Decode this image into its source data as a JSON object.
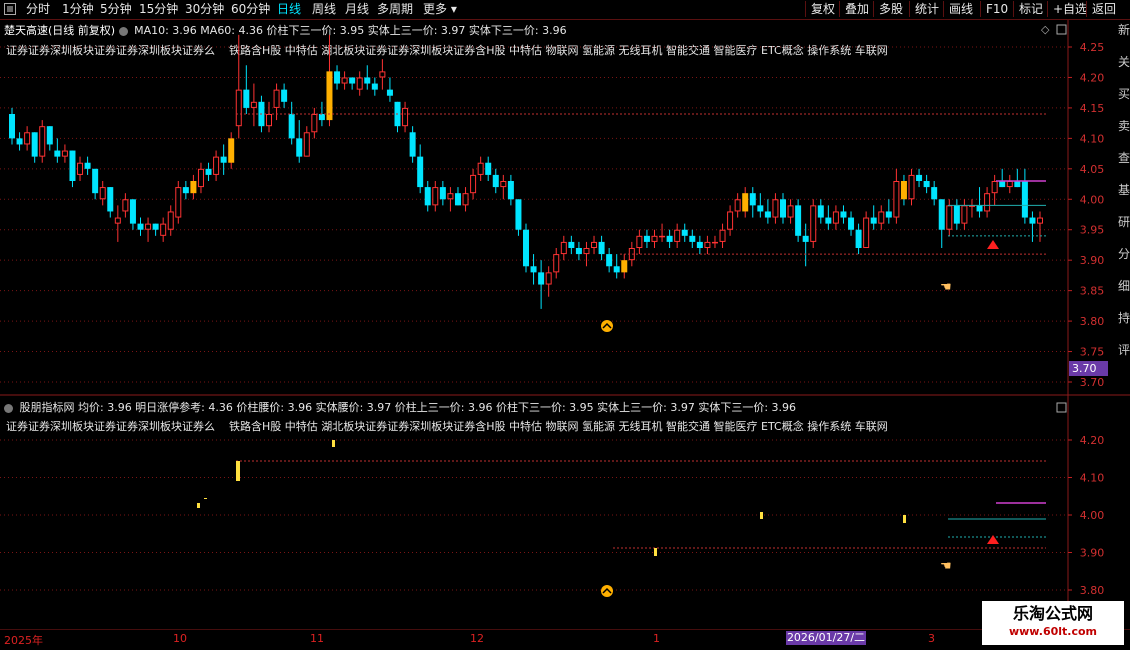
{
  "toolbar": {
    "items": [
      "分时",
      "1分钟",
      "5分钟",
      "15分钟",
      "30分钟",
      "60分钟",
      "日线",
      "周线",
      "月线",
      "多周期",
      "更多"
    ],
    "active": "日线",
    "right_items": [
      "复权",
      "叠加",
      "多股",
      "统计",
      "画线",
      "F10",
      "标记",
      "+自选",
      "返回"
    ]
  },
  "main_panel": {
    "stock_name": "楚天高速(日线 前复权)",
    "ma_text": "MA10: 3.96  MA60: 4.36  价柱下三一价: 3.95  实体上三一价: 3.97  实体下三一价: 3.96",
    "concepts": "证券证券深圳板块证券证券深圳板块证券么",
    "concepts2": "铁路含H股 中特估 湖北板块证券证券深圳板块证券含H股 中特估 物联网 氢能源 无线耳机 智能交通 智能医疗 ETC概念 操作系统 车联网",
    "y_ticks": [
      "4.25",
      "4.20",
      "4.15",
      "4.10",
      "4.05",
      "4.00",
      "3.95",
      "3.90",
      "3.85",
      "3.80",
      "3.75",
      "3.70"
    ],
    "price_tag": "3.70"
  },
  "sub_panel": {
    "indicator_text": "股朋指标网  均价: 3.96  明日涨停参考: 4.36  价柱腰价: 3.96  实体腰价: 3.97  价柱上三一价: 3.96  价柱下三一价: 3.95  实体上三一价: 3.97  实体下三一价: 3.96",
    "concepts": "证券证券深圳板块证券证券深圳板块证券么",
    "concepts2": "铁路含H股 中特估 湖北板块证券证券深圳板块证券含H股 中特估 物联网 氢能源 无线耳机 智能交通 智能医疗 ETC概念 操作系统 车联网",
    "y_ticks": [
      "4.20",
      "4.10",
      "4.00",
      "3.90",
      "3.80"
    ]
  },
  "time_axis": {
    "labels": [
      "2025年",
      "10",
      "11",
      "12",
      "1",
      "3"
    ],
    "date_tag": "2026/01/27/二"
  },
  "side_chars": [
    "新",
    "关",
    "买",
    "卖",
    "查",
    "基",
    "研",
    "分",
    "细",
    "持",
    "评"
  ],
  "watermark": {
    "title": "乐淘公式网",
    "url": "www.60lt.com"
  },
  "colors": {
    "up": "#ff3333",
    "down": "#00e5ff",
    "highlight": "#ffb000",
    "grid": "#7a1515",
    "axis_text": "#d23030",
    "marker": "#ff2020"
  },
  "chart_data": {
    "type": "candlestick",
    "ylim": [
      3.7,
      4.27
    ],
    "note_lines": {
      "upper_level": 4.14,
      "lower_level": 3.91
    },
    "candles": [
      {
        "o": 4.14,
        "h": 4.15,
        "l": 4.09,
        "c": 4.1
      },
      {
        "o": 4.1,
        "h": 4.11,
        "l": 4.08,
        "c": 4.09
      },
      {
        "o": 4.09,
        "h": 4.12,
        "l": 4.08,
        "c": 4.11
      },
      {
        "o": 4.11,
        "h": 4.11,
        "l": 4.06,
        "c": 4.07
      },
      {
        "o": 4.07,
        "h": 4.13,
        "l": 4.06,
        "c": 4.12
      },
      {
        "o": 4.12,
        "h": 4.12,
        "l": 4.08,
        "c": 4.09
      },
      {
        "o": 4.08,
        "h": 4.1,
        "l": 4.06,
        "c": 4.07
      },
      {
        "o": 4.07,
        "h": 4.09,
        "l": 4.06,
        "c": 4.08
      },
      {
        "o": 4.08,
        "h": 4.08,
        "l": 4.02,
        "c": 4.03
      },
      {
        "o": 4.04,
        "h": 4.07,
        "l": 4.03,
        "c": 4.06
      },
      {
        "o": 4.06,
        "h": 4.07,
        "l": 4.04,
        "c": 4.05
      },
      {
        "o": 4.05,
        "h": 4.05,
        "l": 4.0,
        "c": 4.01
      },
      {
        "o": 4.0,
        "h": 4.03,
        "l": 3.99,
        "c": 4.02
      },
      {
        "o": 4.02,
        "h": 4.02,
        "l": 3.97,
        "c": 3.98
      },
      {
        "o": 3.96,
        "h": 3.99,
        "l": 3.93,
        "c": 3.97
      },
      {
        "o": 3.98,
        "h": 4.01,
        "l": 3.97,
        "c": 4.0
      },
      {
        "o": 4.0,
        "h": 4.0,
        "l": 3.95,
        "c": 3.96
      },
      {
        "o": 3.96,
        "h": 3.97,
        "l": 3.94,
        "c": 3.95
      },
      {
        "o": 3.95,
        "h": 3.97,
        "l": 3.93,
        "c": 3.96
      },
      {
        "o": 3.96,
        "h": 3.96,
        "l": 3.94,
        "c": 3.95
      },
      {
        "o": 3.94,
        "h": 3.97,
        "l": 3.93,
        "c": 3.96
      },
      {
        "o": 3.95,
        "h": 3.99,
        "l": 3.94,
        "c": 3.98
      },
      {
        "o": 3.97,
        "h": 4.03,
        "l": 3.96,
        "c": 4.02
      },
      {
        "o": 4.02,
        "h": 4.03,
        "l": 4.0,
        "c": 4.01
      },
      {
        "o": 4.01,
        "h": 4.04,
        "l": 4.0,
        "c": 4.03,
        "hl": true
      },
      {
        "o": 4.02,
        "h": 4.06,
        "l": 4.01,
        "c": 4.05
      },
      {
        "o": 4.05,
        "h": 4.06,
        "l": 4.03,
        "c": 4.04
      },
      {
        "o": 4.04,
        "h": 4.08,
        "l": 4.03,
        "c": 4.07
      },
      {
        "o": 4.07,
        "h": 4.09,
        "l": 4.04,
        "c": 4.06
      },
      {
        "o": 4.06,
        "h": 4.11,
        "l": 4.05,
        "c": 4.1,
        "hl": true
      },
      {
        "o": 4.12,
        "h": 4.27,
        "l": 4.1,
        "c": 4.18
      },
      {
        "o": 4.18,
        "h": 4.22,
        "l": 4.14,
        "c": 4.15
      },
      {
        "o": 4.15,
        "h": 4.19,
        "l": 4.12,
        "c": 4.16
      },
      {
        "o": 4.16,
        "h": 4.17,
        "l": 4.11,
        "c": 4.12
      },
      {
        "o": 4.12,
        "h": 4.16,
        "l": 4.11,
        "c": 4.14
      },
      {
        "o": 4.15,
        "h": 4.19,
        "l": 4.13,
        "c": 4.18
      },
      {
        "o": 4.18,
        "h": 4.19,
        "l": 4.15,
        "c": 4.16
      },
      {
        "o": 4.14,
        "h": 4.16,
        "l": 4.09,
        "c": 4.1
      },
      {
        "o": 4.1,
        "h": 4.13,
        "l": 4.06,
        "c": 4.07
      },
      {
        "o": 4.07,
        "h": 4.12,
        "l": 4.07,
        "c": 4.11
      },
      {
        "o": 4.11,
        "h": 4.15,
        "l": 4.1,
        "c": 4.14
      },
      {
        "o": 4.14,
        "h": 4.16,
        "l": 4.12,
        "c": 4.13
      },
      {
        "o": 4.13,
        "h": 4.27,
        "l": 4.12,
        "c": 4.21,
        "hl": true
      },
      {
        "o": 4.21,
        "h": 4.22,
        "l": 4.18,
        "c": 4.19
      },
      {
        "o": 4.19,
        "h": 4.21,
        "l": 4.18,
        "c": 4.2
      },
      {
        "o": 4.2,
        "h": 4.2,
        "l": 4.18,
        "c": 4.19
      },
      {
        "o": 4.18,
        "h": 4.21,
        "l": 4.17,
        "c": 4.2
      },
      {
        "o": 4.2,
        "h": 4.22,
        "l": 4.18,
        "c": 4.19
      },
      {
        "o": 4.19,
        "h": 4.2,
        "l": 4.17,
        "c": 4.18
      },
      {
        "o": 4.2,
        "h": 4.23,
        "l": 4.18,
        "c": 4.21
      },
      {
        "o": 4.18,
        "h": 4.2,
        "l": 4.16,
        "c": 4.17
      },
      {
        "o": 4.16,
        "h": 4.16,
        "l": 4.11,
        "c": 4.12
      },
      {
        "o": 4.12,
        "h": 4.16,
        "l": 4.11,
        "c": 4.15
      },
      {
        "o": 4.11,
        "h": 4.12,
        "l": 4.06,
        "c": 4.07
      },
      {
        "o": 4.07,
        "h": 4.09,
        "l": 4.01,
        "c": 4.02
      },
      {
        "o": 4.02,
        "h": 4.03,
        "l": 3.98,
        "c": 3.99
      },
      {
        "o": 3.99,
        "h": 4.03,
        "l": 3.98,
        "c": 4.02
      },
      {
        "o": 4.02,
        "h": 4.03,
        "l": 3.99,
        "c": 4.0
      },
      {
        "o": 4.0,
        "h": 4.02,
        "l": 3.98,
        "c": 4.01
      },
      {
        "o": 4.01,
        "h": 4.02,
        "l": 3.99,
        "c": 3.99
      },
      {
        "o": 3.99,
        "h": 4.02,
        "l": 3.98,
        "c": 4.01
      },
      {
        "o": 4.01,
        "h": 4.05,
        "l": 4.0,
        "c": 4.04
      },
      {
        "o": 4.04,
        "h": 4.07,
        "l": 4.03,
        "c": 4.06
      },
      {
        "o": 4.06,
        "h": 4.07,
        "l": 4.03,
        "c": 4.04
      },
      {
        "o": 4.04,
        "h": 4.05,
        "l": 4.01,
        "c": 4.02
      },
      {
        "o": 4.02,
        "h": 4.04,
        "l": 4.0,
        "c": 4.03
      },
      {
        "o": 4.03,
        "h": 4.04,
        "l": 3.99,
        "c": 4.0
      },
      {
        "o": 4.0,
        "h": 4.0,
        "l": 3.94,
        "c": 3.95
      },
      {
        "o": 3.95,
        "h": 3.96,
        "l": 3.88,
        "c": 3.89
      },
      {
        "o": 3.89,
        "h": 3.91,
        "l": 3.86,
        "c": 3.88
      },
      {
        "o": 3.88,
        "h": 3.9,
        "l": 3.82,
        "c": 3.86
      },
      {
        "o": 3.86,
        "h": 3.89,
        "l": 3.84,
        "c": 3.88
      },
      {
        "o": 3.88,
        "h": 3.92,
        "l": 3.87,
        "c": 3.91
      },
      {
        "o": 3.91,
        "h": 3.94,
        "l": 3.9,
        "c": 3.93
      },
      {
        "o": 3.93,
        "h": 3.94,
        "l": 3.91,
        "c": 3.92
      },
      {
        "o": 3.92,
        "h": 3.93,
        "l": 3.9,
        "c": 3.91
      },
      {
        "o": 3.91,
        "h": 3.93,
        "l": 3.89,
        "c": 3.92
      },
      {
        "o": 3.92,
        "h": 3.94,
        "l": 3.91,
        "c": 3.93
      },
      {
        "o": 3.93,
        "h": 3.94,
        "l": 3.9,
        "c": 3.91
      },
      {
        "o": 3.91,
        "h": 3.92,
        "l": 3.88,
        "c": 3.89
      },
      {
        "o": 3.89,
        "h": 3.91,
        "l": 3.87,
        "c": 3.88
      },
      {
        "o": 3.88,
        "h": 3.91,
        "l": 3.87,
        "c": 3.9,
        "hl": true
      },
      {
        "o": 3.9,
        "h": 3.93,
        "l": 3.89,
        "c": 3.92
      },
      {
        "o": 3.92,
        "h": 3.95,
        "l": 3.91,
        "c": 3.94
      },
      {
        "o": 3.94,
        "h": 3.95,
        "l": 3.92,
        "c": 3.93
      },
      {
        "o": 3.93,
        "h": 3.95,
        "l": 3.92,
        "c": 3.94
      },
      {
        "o": 3.94,
        "h": 3.96,
        "l": 3.93,
        "c": 3.94
      },
      {
        "o": 3.94,
        "h": 3.95,
        "l": 3.92,
        "c": 3.93
      },
      {
        "o": 3.93,
        "h": 3.96,
        "l": 3.92,
        "c": 3.95
      },
      {
        "o": 3.95,
        "h": 3.96,
        "l": 3.93,
        "c": 3.94
      },
      {
        "o": 3.94,
        "h": 3.95,
        "l": 3.92,
        "c": 3.93
      },
      {
        "o": 3.93,
        "h": 3.94,
        "l": 3.91,
        "c": 3.92
      },
      {
        "o": 3.92,
        "h": 3.94,
        "l": 3.91,
        "c": 3.93
      },
      {
        "o": 3.93,
        "h": 3.94,
        "l": 3.92,
        "c": 3.93
      },
      {
        "o": 3.93,
        "h": 3.96,
        "l": 3.92,
        "c": 3.95
      },
      {
        "o": 3.95,
        "h": 3.99,
        "l": 3.94,
        "c": 3.98
      },
      {
        "o": 3.98,
        "h": 4.01,
        "l": 3.97,
        "c": 4.0
      },
      {
        "o": 3.98,
        "h": 4.02,
        "l": 3.97,
        "c": 4.01,
        "hl": true
      },
      {
        "o": 4.01,
        "h": 4.02,
        "l": 3.97,
        "c": 3.99
      },
      {
        "o": 3.99,
        "h": 4.01,
        "l": 3.97,
        "c": 3.98
      },
      {
        "o": 3.98,
        "h": 4.0,
        "l": 3.96,
        "c": 3.97
      },
      {
        "o": 3.97,
        "h": 4.01,
        "l": 3.96,
        "c": 4.0
      },
      {
        "o": 4.0,
        "h": 4.01,
        "l": 3.96,
        "c": 3.97
      },
      {
        "o": 3.97,
        "h": 4.0,
        "l": 3.96,
        "c": 3.99
      },
      {
        "o": 3.99,
        "h": 4.0,
        "l": 3.93,
        "c": 3.94
      },
      {
        "o": 3.94,
        "h": 3.96,
        "l": 3.89,
        "c": 3.93
      },
      {
        "o": 3.93,
        "h": 4.0,
        "l": 3.92,
        "c": 3.99
      },
      {
        "o": 3.99,
        "h": 4.0,
        "l": 3.96,
        "c": 3.97
      },
      {
        "o": 3.97,
        "h": 3.99,
        "l": 3.95,
        "c": 3.96
      },
      {
        "o": 3.96,
        "h": 3.99,
        "l": 3.95,
        "c": 3.98
      },
      {
        "o": 3.98,
        "h": 3.99,
        "l": 3.96,
        "c": 3.97
      },
      {
        "o": 3.97,
        "h": 3.98,
        "l": 3.94,
        "c": 3.95
      },
      {
        "o": 3.95,
        "h": 3.96,
        "l": 3.91,
        "c": 3.92
      },
      {
        "o": 3.92,
        "h": 3.98,
        "l": 3.92,
        "c": 3.97
      },
      {
        "o": 3.97,
        "h": 3.99,
        "l": 3.95,
        "c": 3.96
      },
      {
        "o": 3.96,
        "h": 3.99,
        "l": 3.95,
        "c": 3.98
      },
      {
        "o": 3.98,
        "h": 4.0,
        "l": 3.96,
        "c": 3.97
      },
      {
        "o": 3.97,
        "h": 4.05,
        "l": 3.96,
        "c": 4.03
      },
      {
        "o": 4.03,
        "h": 4.04,
        "l": 3.99,
        "c": 4.0,
        "hl": true
      },
      {
        "o": 4.0,
        "h": 4.05,
        "l": 3.99,
        "c": 4.04
      },
      {
        "o": 4.04,
        "h": 4.05,
        "l": 4.02,
        "c": 4.03
      },
      {
        "o": 4.03,
        "h": 4.04,
        "l": 4.01,
        "c": 4.02
      },
      {
        "o": 4.02,
        "h": 4.03,
        "l": 3.99,
        "c": 4.0
      },
      {
        "o": 4.0,
        "h": 4.0,
        "l": 3.92,
        "c": 3.95
      },
      {
        "o": 3.95,
        "h": 4.0,
        "l": 3.94,
        "c": 3.99
      },
      {
        "o": 3.99,
        "h": 4.0,
        "l": 3.95,
        "c": 3.96
      },
      {
        "o": 3.96,
        "h": 4.0,
        "l": 3.95,
        "c": 3.99
      },
      {
        "o": 3.99,
        "h": 4.0,
        "l": 3.97,
        "c": 3.99
      },
      {
        "o": 3.99,
        "h": 4.02,
        "l": 3.97,
        "c": 3.98
      },
      {
        "o": 3.98,
        "h": 4.02,
        "l": 3.97,
        "c": 4.01
      },
      {
        "o": 4.01,
        "h": 4.04,
        "l": 3.99,
        "c": 4.03
      },
      {
        "o": 4.03,
        "h": 4.05,
        "l": 4.02,
        "c": 4.02
      },
      {
        "o": 4.02,
        "h": 4.04,
        "l": 4.01,
        "c": 4.03
      },
      {
        "o": 4.03,
        "h": 4.05,
        "l": 4.02,
        "c": 4.02
      },
      {
        "o": 4.03,
        "h": 4.05,
        "l": 3.96,
        "c": 3.97
      },
      {
        "o": 3.97,
        "h": 3.98,
        "l": 3.93,
        "c": 3.96
      },
      {
        "o": 3.96,
        "h": 3.98,
        "l": 3.93,
        "c": 3.97
      }
    ]
  }
}
